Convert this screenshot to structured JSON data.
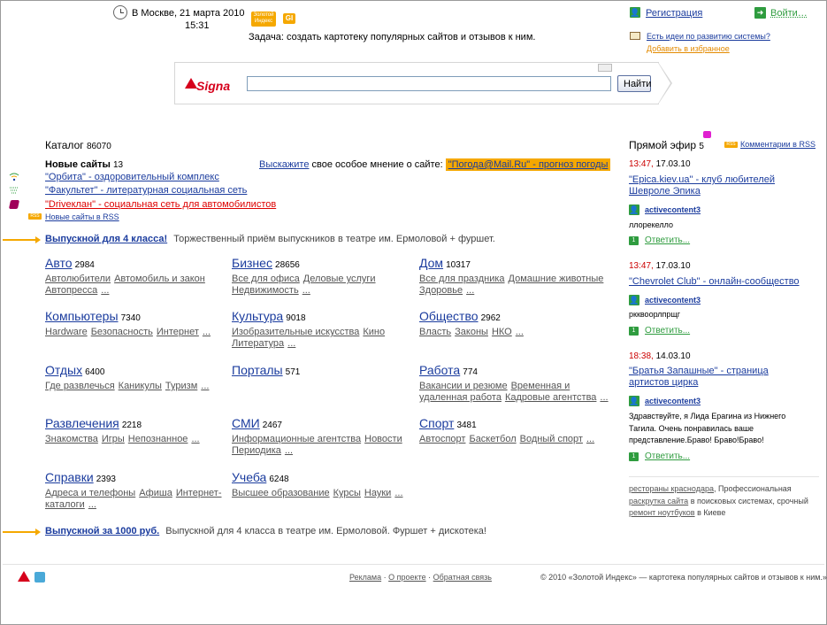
{
  "header": {
    "location_date": "В Москве,  21 марта 2010",
    "time": "15:31",
    "logo_text": "Золотой Индекс",
    "gi_badge": "GI",
    "task": "Задача: создать картотеку популярных сайтов и отзывов к ним.",
    "register": "Регистрация",
    "login": "Войти…",
    "ideas": "Есть идеи по развитию системы?",
    "favorites": "Добавить в избранное"
  },
  "search": {
    "logo": "Signa",
    "value": "",
    "button": "Найти"
  },
  "catalog": {
    "title": "Каталог",
    "count": "86070",
    "new_sites_title": "Новые сайты",
    "new_sites_count": "13",
    "new_sites": [
      {
        "text": "\"Орбита\" - оздоровительный комплекс",
        "color": "#1b3c9e"
      },
      {
        "text": "\"Факультет\" - литературная социальная сеть",
        "color": "#1b3c9e"
      },
      {
        "text": "\"Driveклан\" - социальная сеть для автомобилистов",
        "color": "#dd0000"
      }
    ],
    "rss_badge": "RSS",
    "new_sites_rss": "Новые сайты в RSS",
    "opinion_link": "Выскажите",
    "opinion_text": "свое особое мнение о сайте:",
    "opinion_site": "\"Погода@Mail.Ru\" - прогноз погоды",
    "promo1_link": "Выпускной для 4 класса!",
    "promo1_text": "Торжественный приём выпускников в театре им. Ермоловой + фуршет.",
    "promo2_link": "Выпускной за 1000 руб.",
    "promo2_text": "Выпускной для 4 класса в театре им. Ермоловой. Фуршет + дискотека!",
    "categories": [
      {
        "title": "Авто",
        "count": "2984",
        "line1": [
          "Автолюбители",
          "Автомобиль и закон"
        ],
        "line2": [
          "Автопресса",
          "..."
        ]
      },
      {
        "title": "Бизнес",
        "count": "28656",
        "line1": [
          "Все для офиса",
          "Деловые услуги"
        ],
        "line2": [
          "Недвижимость",
          "..."
        ]
      },
      {
        "title": "Дом",
        "count": "10317",
        "line1": [
          "Все для праздника",
          "Домашние животные"
        ],
        "line2": [
          "Здоровье",
          "..."
        ]
      },
      {
        "title": "Компьютеры",
        "count": "7340",
        "line1": [
          "Hardware",
          "Безопасность",
          "Интернет",
          "..."
        ],
        "line2": []
      },
      {
        "title": "Культура",
        "count": "9018",
        "line1": [
          "Изобразительные искусства",
          "Кино"
        ],
        "line2": [
          "Литература",
          "..."
        ]
      },
      {
        "title": "Общество",
        "count": "2962",
        "line1": [
          "Власть",
          "Законы",
          "НКО",
          "..."
        ],
        "line2": []
      },
      {
        "title": "Отдых",
        "count": "6400",
        "line1": [
          "Где развлечься",
          "Каникулы",
          "Туризм",
          "..."
        ],
        "line2": []
      },
      {
        "title": "Порталы",
        "count": "571",
        "line1": [],
        "line2": []
      },
      {
        "title": "Работа",
        "count": "774",
        "line1": [
          "Вакансии и резюме",
          "Временная и"
        ],
        "line2": [
          "удаленная работа",
          "Кадровые агентства",
          "..."
        ]
      },
      {
        "title": "Развлечения",
        "count": "2218",
        "line1": [
          "Знакомства",
          "Игры",
          "Непознанное",
          "..."
        ],
        "line2": []
      },
      {
        "title": "СМИ",
        "count": "2467",
        "line1": [
          "Информационные агентства",
          "Новости"
        ],
        "line2": [
          "Периодика",
          "..."
        ]
      },
      {
        "title": "Спорт",
        "count": "3481",
        "line1": [
          "Автоспорт",
          "Баскетбол",
          "Водный спорт",
          "..."
        ],
        "line2": []
      },
      {
        "title": "Справки",
        "count": "2393",
        "line1": [
          "Адреса и телефоны",
          "Афиша",
          "Интернет-"
        ],
        "line2": [
          "каталоги",
          "..."
        ]
      },
      {
        "title": "Учеба",
        "count": "6248",
        "line1": [
          "Высшее образование",
          "Курсы",
          "Науки",
          "..."
        ],
        "line2": []
      }
    ]
  },
  "feed": {
    "title": "Прямой эфир",
    "count": "5",
    "rss_badge": "RSS",
    "rss_link": "Комментарии в RSS",
    "items": [
      {
        "time": "13:47,",
        "date": "17.03.10",
        "site": "\"Epica.kiev.ua\" - клуб любителей Шевроле Эпика",
        "user": "activecontent3",
        "comment": "ллорекелло",
        "badge": "1",
        "reply": "Ответить..."
      },
      {
        "time": "13:47,",
        "date": "17.03.10",
        "site": "\"Chevrolet Club\" - онлайн-сообщество",
        "user": "activecontent3",
        "comment": "ркквоорлпрщг",
        "badge": "1",
        "reply": "Ответить..."
      },
      {
        "time": "18:38,",
        "date": "14.03.10",
        "site": "\"Братья Запашные\" - страница артистов цирка",
        "user": "activecontent3",
        "comment": "Здравствуйте, я Лида Ерагина из Нижнего Тагила. Очень понравилась ваше представление.Браво! Браво!Браво!",
        "badge": "1",
        "reply": "Ответить..."
      }
    ],
    "ad": {
      "part1": "рестораны краснодара",
      "part2": ", Профессиональная ",
      "part3": "раскрутка сайта",
      "part4": " в поисковых системах, срочный ",
      "part5": "ремонт ноутбуков",
      "part6": " в Киеве"
    }
  },
  "footer": {
    "links": [
      "Реклама",
      "О проекте",
      "Обратная связь"
    ],
    "dot": "·",
    "copyright": "© 2010 «Золотой Индекс» — картотека популярных сайтов и отзывов к ним.»"
  }
}
